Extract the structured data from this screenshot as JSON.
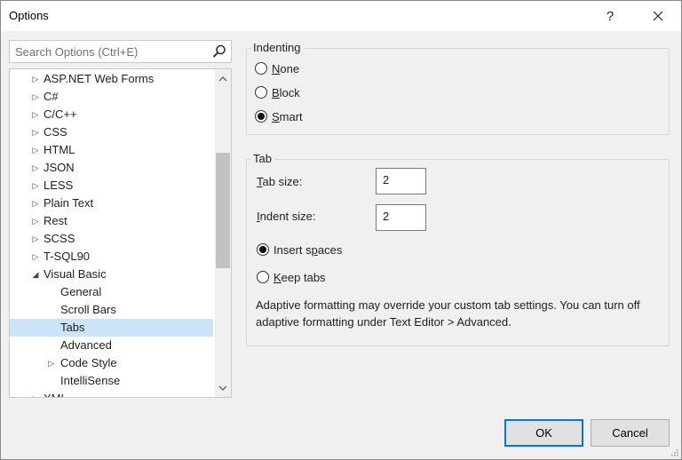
{
  "window": {
    "title": "Options",
    "help_symbol": "?",
    "close_symbol": "✕"
  },
  "search": {
    "placeholder": "Search Options (Ctrl+E)",
    "icon": "search-icon"
  },
  "tree": {
    "items": [
      {
        "label": "ASP.NET Web Forms",
        "level": 1,
        "expander": "collapsed"
      },
      {
        "label": "C#",
        "level": 1,
        "expander": "collapsed"
      },
      {
        "label": "C/C++",
        "level": 1,
        "expander": "collapsed"
      },
      {
        "label": "CSS",
        "level": 1,
        "expander": "collapsed"
      },
      {
        "label": "HTML",
        "level": 1,
        "expander": "collapsed"
      },
      {
        "label": "JSON",
        "level": 1,
        "expander": "collapsed"
      },
      {
        "label": "LESS",
        "level": 1,
        "expander": "collapsed"
      },
      {
        "label": "Plain Text",
        "level": 1,
        "expander": "collapsed"
      },
      {
        "label": "Rest",
        "level": 1,
        "expander": "collapsed"
      },
      {
        "label": "SCSS",
        "level": 1,
        "expander": "collapsed"
      },
      {
        "label": "T-SQL90",
        "level": 1,
        "expander": "collapsed"
      },
      {
        "label": "Visual Basic",
        "level": 1,
        "expander": "expanded"
      },
      {
        "label": "General",
        "level": 2,
        "expander": "none"
      },
      {
        "label": "Scroll Bars",
        "level": 2,
        "expander": "none"
      },
      {
        "label": "Tabs",
        "level": 2,
        "expander": "none",
        "selected": true
      },
      {
        "label": "Advanced",
        "level": 2,
        "expander": "none"
      },
      {
        "label": "Code Style",
        "level": 2,
        "expander": "collapsed"
      },
      {
        "label": "IntelliSense",
        "level": 2,
        "expander": "none"
      },
      {
        "label": "XML",
        "level": 1,
        "expander": "collapsed"
      }
    ]
  },
  "indenting": {
    "title": "Indenting",
    "options": [
      {
        "label": "None",
        "mnemonic": "N",
        "rest": "one",
        "checked": false
      },
      {
        "label": "Block",
        "mnemonic": "B",
        "rest": "lock",
        "checked": false
      },
      {
        "label": "Smart",
        "mnemonic": "S",
        "rest": "mart",
        "checked": true
      }
    ]
  },
  "tab": {
    "title": "Tab",
    "tab_size_label_m": "T",
    "tab_size_label_rest": "ab size:",
    "tab_size_value": "2",
    "indent_size_label_m": "I",
    "indent_size_label_rest": "ndent size:",
    "indent_size_value": "2",
    "insert_spaces_pre": "Insert s",
    "insert_spaces_m": "p",
    "insert_spaces_post": "aces",
    "insert_spaces_checked": true,
    "keep_tabs_m": "K",
    "keep_tabs_rest": "eep tabs",
    "keep_tabs_checked": false,
    "info": "Adaptive formatting may override your custom tab settings. You can turn off adaptive formatting under Text Editor > Advanced."
  },
  "buttons": {
    "ok": "OK",
    "cancel": "Cancel"
  }
}
